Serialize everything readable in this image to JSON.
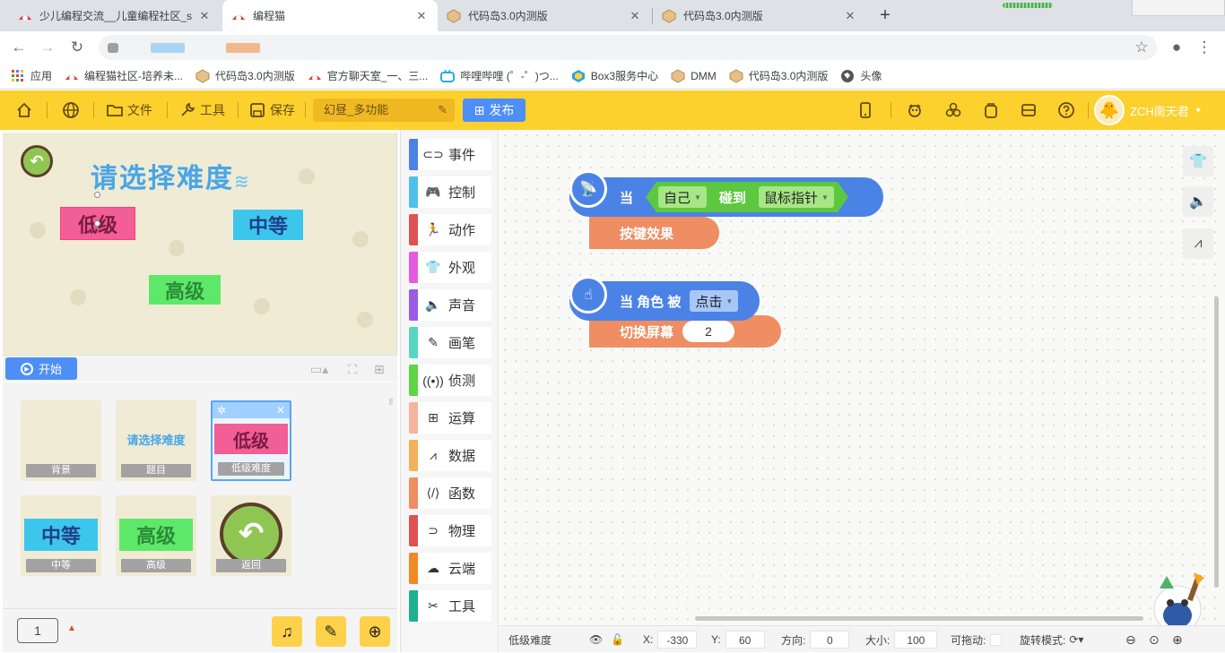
{
  "browser": {
    "tabs": [
      {
        "title": "少儿编程交流__儿童编程社区_sc",
        "active": false,
        "icon": "bcm-icon"
      },
      {
        "title": "编程猫",
        "active": true,
        "icon": "bcm-icon"
      },
      {
        "title": "代码岛3.0内测版",
        "active": false,
        "icon": "box-icon"
      },
      {
        "title": "代码岛3.0内测版",
        "active": false,
        "icon": "box-icon"
      }
    ],
    "bookmarks": [
      {
        "label": "应用",
        "icon": "apps-grid-icon"
      },
      {
        "label": "编程猫社区-培养未...",
        "icon": "bcm-icon"
      },
      {
        "label": "代码岛3.0内测版",
        "icon": "box-icon"
      },
      {
        "label": "官方聊天室_一、三...",
        "icon": "bcm-icon"
      },
      {
        "label": "哔哩哔哩 (゜-゜)つ...",
        "icon": "bilibili-icon"
      },
      {
        "label": "Box3服务中心",
        "icon": "box3-icon"
      },
      {
        "label": "DMM",
        "icon": "box-icon"
      },
      {
        "label": "代码岛3.0内测版",
        "icon": "box-icon"
      },
      {
        "label": "头像",
        "icon": "globe-icon"
      }
    ]
  },
  "toolbar": {
    "file_label": "文件",
    "tools_label": "工具",
    "save_label": "保存",
    "project_name": "幻昼_多功能",
    "publish_label": "发布",
    "username": "ZCH南天君"
  },
  "stage": {
    "title_text": "请选择难度",
    "buttons": {
      "low": "低级",
      "mid": "中等",
      "high": "高级"
    },
    "start_label": "开始"
  },
  "sprites": [
    {
      "label": "背景",
      "thumb": ""
    },
    {
      "label": "题目",
      "thumb": "请选择难度"
    },
    {
      "label": "低级难度",
      "thumb": "低级",
      "selected": true
    },
    {
      "label": "中等",
      "thumb": "中等"
    },
    {
      "label": "高级",
      "thumb": "高级"
    },
    {
      "label": "返回",
      "thumb": ""
    }
  ],
  "page_number": "1",
  "categories": [
    {
      "label": "事件",
      "color": "#4b82e6",
      "icon": "toggle-icon"
    },
    {
      "label": "控制",
      "color": "#4fc1e9",
      "icon": "gamepad-icon"
    },
    {
      "label": "动作",
      "color": "#e05252",
      "icon": "run-icon"
    },
    {
      "label": "外观",
      "color": "#e35ce0",
      "icon": "shirt-icon"
    },
    {
      "label": "声音",
      "color": "#9a5ce5",
      "icon": "speaker-icon"
    },
    {
      "label": "画笔",
      "color": "#56d6c0",
      "icon": "pen-icon"
    },
    {
      "label": "侦测",
      "color": "#5fd444",
      "icon": "sensor-icon"
    },
    {
      "label": "运算",
      "color": "#f5b59c",
      "icon": "calc-icon"
    },
    {
      "label": "数据",
      "color": "#f2b25b",
      "icon": "data-icon"
    },
    {
      "label": "函数",
      "color": "#ef8d63",
      "icon": "function-icon"
    },
    {
      "label": "物理",
      "color": "#e05252",
      "icon": "magnet-icon"
    },
    {
      "label": "云端",
      "color": "#f08a24",
      "icon": "cloud-icon"
    },
    {
      "label": "工具",
      "color": "#1fb08e",
      "icon": "tools-icon"
    }
  ],
  "code": {
    "script1": {
      "when": "当",
      "self": "自己",
      "touch": "碰到",
      "target": "鼠标指针",
      "action": "按键效果"
    },
    "script2": {
      "when": "当 角色 被",
      "event": "点击",
      "action": "切换屏幕",
      "value": "2"
    }
  },
  "status": {
    "sprite_name": "低级难度",
    "x_label": "X:",
    "x": "-330",
    "y_label": "Y:",
    "y": "60",
    "dir_label": "方向:",
    "dir": "0",
    "size_label": "大小:",
    "size": "100",
    "drag_label": "可拖动:",
    "rot_label": "旋转模式:"
  }
}
